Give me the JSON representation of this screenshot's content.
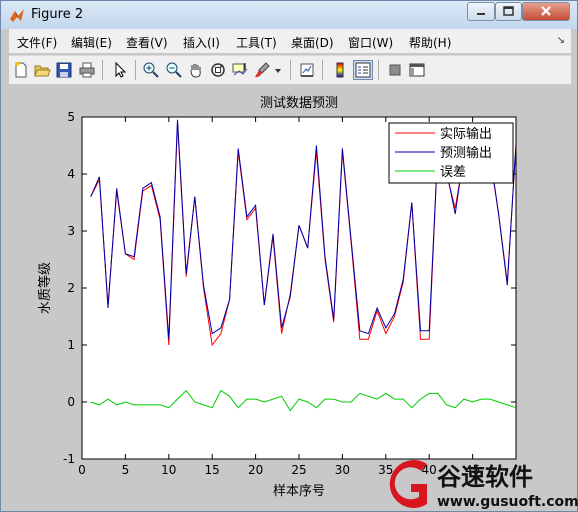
{
  "window": {
    "title": "Figure 2",
    "min_label": "▬",
    "max_label": "□",
    "close_label": "✕"
  },
  "menu": [
    "文件(F)",
    "编辑(E)",
    "查看(V)",
    "插入(I)",
    "工具(T)",
    "桌面(D)",
    "窗口(W)",
    "帮助(H)"
  ],
  "menu_overflow": "↘",
  "toolbar_icons": [
    "new-file-icon",
    "open-folder-icon",
    "save-icon",
    "print-icon",
    "pointer-icon",
    "zoom-in-icon",
    "zoom-out-icon",
    "pan-hand-icon",
    "rotate-3d-icon",
    "data-cursor-icon",
    "brush-icon",
    "dropdown-arrow-icon",
    "link-plot-icon",
    "colorbar-icon",
    "legend-icon",
    "hide-plot-tools-icon",
    "show-plot-tools-icon"
  ],
  "watermark": {
    "brand": "谷速软件",
    "url": "www.gusuoft.com"
  },
  "chart_data": {
    "type": "line",
    "title": "测试数据预测",
    "xlabel": "样本序号",
    "ylabel": "水质等级",
    "xlim": [
      0,
      50
    ],
    "ylim": [
      -1,
      5
    ],
    "xticks": [
      0,
      5,
      10,
      15,
      20,
      25,
      30,
      35,
      40,
      45
    ],
    "yticks": [
      -1,
      0,
      1,
      2,
      3,
      4,
      5
    ],
    "legend_position": "top-right",
    "colors": {
      "actual": "#ff0000",
      "predicted": "#0000aa",
      "error": "#00cc00"
    },
    "x": [
      1,
      2,
      3,
      4,
      5,
      6,
      7,
      8,
      9,
      10,
      11,
      12,
      13,
      14,
      15,
      16,
      17,
      18,
      19,
      20,
      21,
      22,
      23,
      24,
      25,
      26,
      27,
      28,
      29,
      30,
      31,
      32,
      33,
      34,
      35,
      36,
      37,
      38,
      39,
      40,
      41,
      42,
      43,
      44,
      45,
      46,
      47,
      48,
      49,
      50
    ],
    "series": [
      {
        "name": "实际输出",
        "key": "actual",
        "values": [
          3.6,
          3.9,
          1.7,
          3.7,
          2.6,
          2.5,
          3.7,
          3.8,
          3.2,
          1.0,
          4.9,
          2.2,
          3.6,
          2.0,
          1.0,
          1.2,
          1.8,
          4.4,
          3.2,
          3.4,
          1.7,
          2.9,
          1.2,
          1.9,
          3.1,
          2.7,
          4.4,
          2.5,
          1.4,
          4.4,
          2.8,
          1.1,
          1.1,
          1.6,
          1.2,
          1.5,
          2.1,
          3.5,
          1.1,
          1.1,
          4.5,
          4.0,
          3.4,
          4.3,
          4.1,
          4.3,
          4.3,
          3.3,
          2.1,
          4.5
        ]
      },
      {
        "name": "预测输出",
        "key": "predicted",
        "values": [
          3.6,
          3.95,
          1.65,
          3.75,
          2.6,
          2.55,
          3.75,
          3.85,
          3.25,
          1.1,
          4.95,
          2.25,
          3.6,
          2.05,
          1.2,
          1.3,
          1.8,
          4.45,
          3.25,
          3.45,
          1.7,
          2.95,
          1.3,
          1.85,
          3.1,
          2.7,
          4.5,
          2.55,
          1.45,
          4.45,
          2.85,
          1.25,
          1.2,
          1.65,
          1.3,
          1.55,
          2.15,
          3.5,
          1.25,
          1.25,
          4.5,
          4.05,
          3.3,
          4.35,
          4.1,
          4.35,
          4.35,
          3.3,
          2.05,
          4.55
        ]
      },
      {
        "name": "误差",
        "key": "error",
        "values": [
          0.0,
          -0.05,
          0.05,
          -0.05,
          0.0,
          -0.05,
          -0.05,
          -0.05,
          -0.05,
          -0.1,
          0.05,
          0.2,
          0.0,
          -0.05,
          -0.1,
          0.2,
          0.1,
          -0.1,
          0.05,
          0.05,
          0.0,
          0.05,
          0.1,
          -0.15,
          0.05,
          0.0,
          -0.1,
          0.05,
          0.05,
          0.0,
          0.0,
          0.15,
          0.1,
          0.05,
          0.15,
          0.05,
          0.05,
          -0.1,
          0.05,
          0.15,
          0.15,
          -0.05,
          -0.1,
          0.05,
          0.0,
          0.05,
          0.05,
          0.0,
          -0.05,
          -0.1
        ]
      }
    ]
  }
}
